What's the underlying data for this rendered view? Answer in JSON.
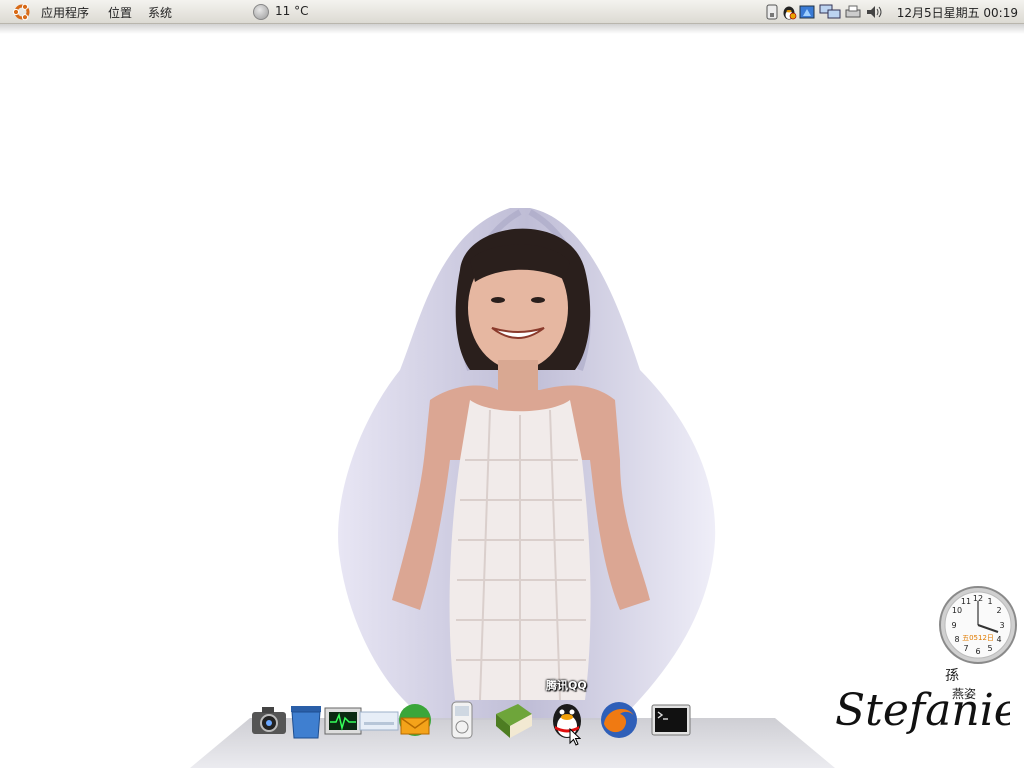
{
  "top_panel": {
    "menus": [
      "应用程序",
      "位置",
      "系统"
    ],
    "weather": {
      "temperature": "11 °C",
      "icon": "weather-icon"
    },
    "tray_icons": [
      "usb-drive-icon",
      "qq-tray-icon",
      "network-file-icon",
      "network-monitor-icon",
      "printer-icon",
      "volume-icon"
    ],
    "clock": "12月5日星期五 00:19"
  },
  "desktop": {
    "clock_widget": {
      "date_text": "五0512日"
    },
    "signature": {
      "latin": "Stefanie",
      "chinese_lines": [
        "孫",
        "燕姿"
      ]
    }
  },
  "dock": {
    "items": [
      "camera-icon",
      "trash-icon",
      "system-monitor-icon",
      "disk-icon",
      "mail-icon",
      "music-player-icon",
      "book-icon",
      "qq-icon",
      "firefox-icon",
      "terminal-icon"
    ],
    "hover_label": "腾讯QQ"
  }
}
